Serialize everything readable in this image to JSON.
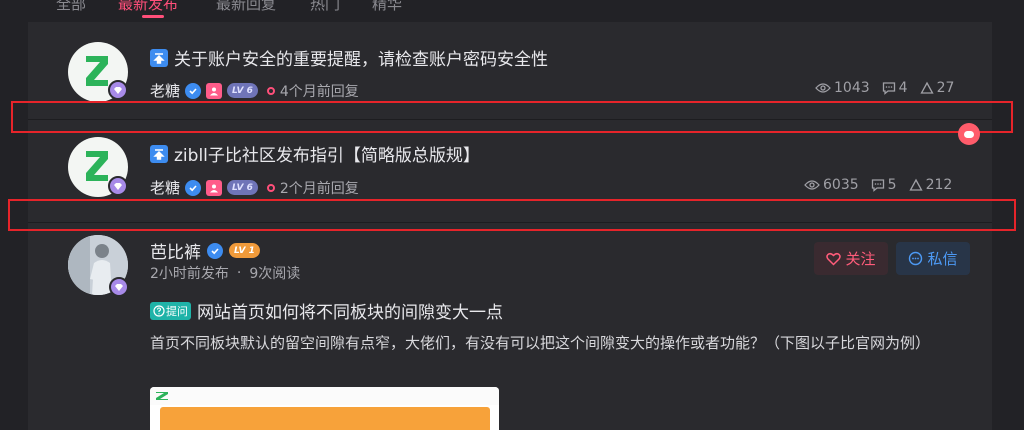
{
  "tabs": [
    {
      "label": "全部"
    },
    {
      "label": "最新发布"
    },
    {
      "label": "最新回复"
    },
    {
      "label": "热门"
    },
    {
      "label": "精华"
    }
  ],
  "colors": {
    "accent": "#ff4f7a",
    "blue": "#3d8cf0",
    "vip": "#a78ae8",
    "highlight_box": "#e6242a"
  },
  "posts": [
    {
      "title": "关于账户安全的重要提醒，请检查账户密码安全性",
      "author": "老糖",
      "level": "LV 6",
      "time": "4个月前回复",
      "views": "1043",
      "comments": "4",
      "likes": "27"
    },
    {
      "title": "zibll子比社区发布指引【简略版总版规】",
      "author": "老糖",
      "level": "LV 6",
      "time": "2个月前回复",
      "views": "6035",
      "comments": "5",
      "likes": "212"
    }
  ],
  "question_post": {
    "author": "芭比裤",
    "level": "LV 1",
    "published": "2小时前发布",
    "reads": "9次阅读",
    "follow_label": "关注",
    "message_label": "私信",
    "tag": "提问",
    "title": "网站首页如何将不同板块的间隙变大一点",
    "excerpt": "首页不同板块默认的留空间隙有点窄，大佬们，有没有可以把这个间隙变大的操作或者功能？（下图以子比官网为例）"
  },
  "icons": [
    "eye-icon",
    "comment-icon",
    "like-icon",
    "verified-icon",
    "admin-icon",
    "vip-diamond-icon",
    "heart-icon",
    "chat-icon",
    "sticky-icon",
    "question-icon"
  ]
}
